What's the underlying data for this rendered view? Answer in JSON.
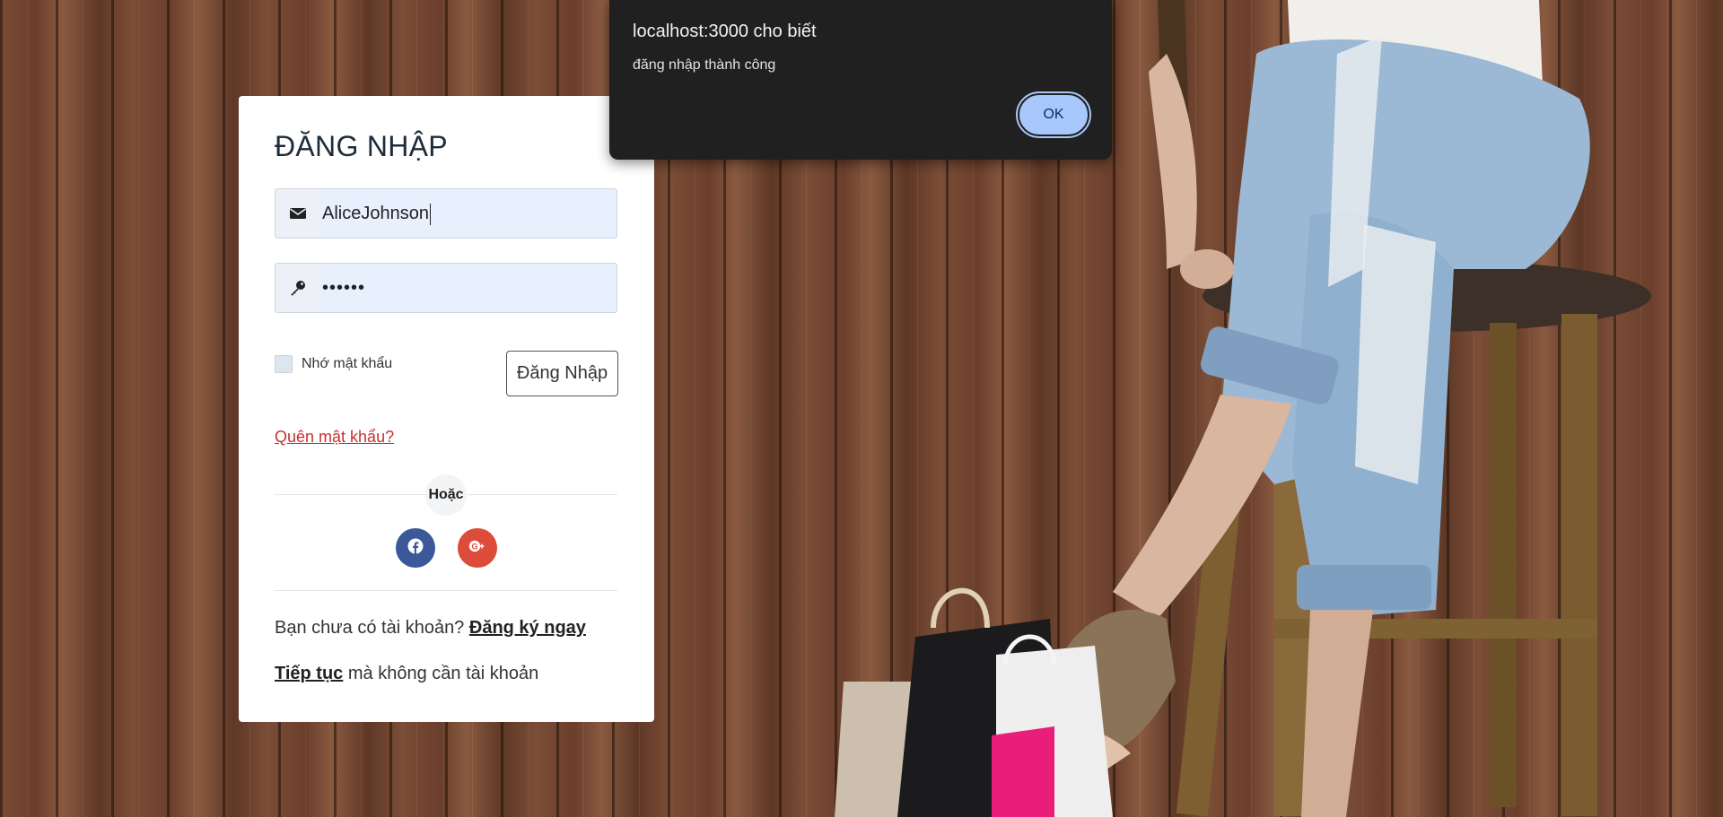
{
  "dialog": {
    "title": "localhost:3000 cho biết",
    "message": "đăng nhập thành công",
    "ok_label": "OK"
  },
  "login": {
    "title": "ĐĂNG NHẬP",
    "username_value": "AliceJohnson",
    "password_value": "••••••",
    "remember_label": "Nhớ mật khẩu",
    "submit_label": "Đăng Nhập",
    "forgot_label": "Quên mật khẩu?",
    "or_label": "Hoặc",
    "signup_prompt": "Bạn chưa có tài khoản?",
    "signup_link": "Đăng ký ngay",
    "continue_link": "Tiếp tục",
    "continue_suffix": "mà không cần tài khoản"
  },
  "icons": {
    "username": "envelope-icon",
    "password": "key-icon",
    "facebook": "facebook-icon",
    "google": "google-plus-icon"
  },
  "colors": {
    "facebook": "#3b5998",
    "google": "#dd4b39",
    "forgot_link": "#c9302c",
    "dialog_bg": "#202020",
    "ok_button": "#a8c7fa"
  }
}
